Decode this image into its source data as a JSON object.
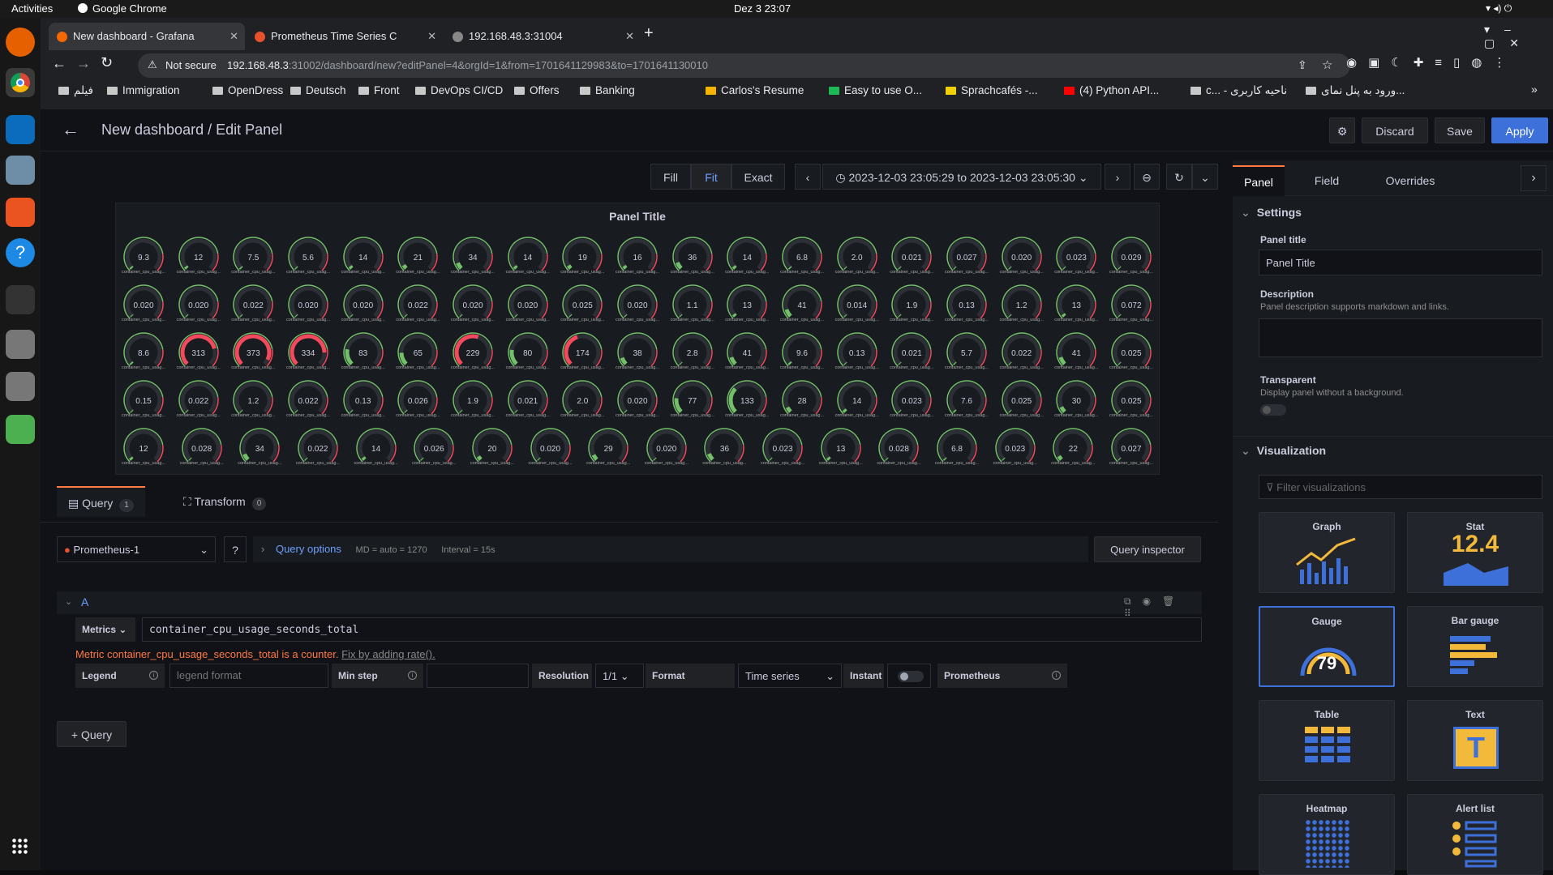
{
  "os": {
    "activities": "Activities",
    "app": "Google Chrome",
    "clock": "Dez 3  23:07"
  },
  "browser": {
    "tabs": [
      {
        "title": "New dashboard - Grafana",
        "active": true
      },
      {
        "title": "Prometheus Time Series C"
      },
      {
        "title": "192.168.48.3:31004"
      }
    ],
    "not_secure": "Not secure",
    "url_host": "192.168.48.3",
    "url_rest": ":31002/dashboard/new?editPanel=4&orgId=1&from=1701641129983&to=1701641130010",
    "bookmarks": [
      "فیلم",
      "Immigration",
      "OpenDress",
      "Deutsch",
      "Front",
      "DevOps CI/CD",
      "Offers",
      "Banking",
      "Carlos's Resume",
      "Easy to use O...",
      "Sprachcafés -...",
      "(4) Python API...",
      "c... - ناحیه کاربری",
      "ورود به پنل نمای..."
    ]
  },
  "header": {
    "breadcrumb": "New dashboard / Edit Panel",
    "discard": "Discard",
    "save": "Save",
    "apply": "Apply"
  },
  "toolbar": {
    "fill": "Fill",
    "fit": "Fit",
    "exact": "Exact",
    "time_range": "2023-12-03 23:05:29 to 2023-12-03 23:05:30"
  },
  "panel": {
    "title": "Panel Title",
    "gauge_label": "container_cpu_usag...",
    "gauges": [
      [
        "9.3",
        "12",
        "7.5",
        "5.6",
        "14",
        "21",
        "34",
        "14",
        "19",
        "16",
        "36",
        "14",
        "6.8",
        "2.0",
        "0.021",
        "0.027",
        "0.020",
        "0.023",
        "0.029"
      ],
      [
        "0.020",
        "0.020",
        "0.022",
        "0.020",
        "0.020",
        "0.022",
        "0.020",
        "0.020",
        "0.025",
        "0.020",
        "1.1",
        "13",
        "41",
        "0.014",
        "1.9",
        "0.13",
        "1.2",
        "13",
        "0.072"
      ],
      [
        "8.6",
        "313",
        "373",
        "334",
        "83",
        "65",
        "229",
        "80",
        "174",
        "38",
        "2.8",
        "41",
        "9.6",
        "0.13",
        "0.021",
        "5.7",
        "0.022",
        "41",
        "0.025"
      ],
      [
        "0.15",
        "0.022",
        "1.2",
        "0.022",
        "0.13",
        "0.026",
        "1.9",
        "0.021",
        "2.0",
        "0.020",
        "77",
        "133",
        "28",
        "14",
        "0.023",
        "7.6",
        "0.025",
        "30",
        "0.025"
      ],
      [
        "12",
        "0.028",
        "34",
        "0.022",
        "14",
        "0.026",
        "20",
        "0.020",
        "29",
        "0.020",
        "36",
        "0.023",
        "13",
        "0.028",
        "6.8",
        "0.023",
        "22",
        "0.027"
      ]
    ],
    "gauge_max": 400
  },
  "query": {
    "tab_query": "Query",
    "tab_query_count": "1",
    "tab_transform": "Transform",
    "tab_transform_count": "0",
    "datasource": "Prometheus-1",
    "query_options": "Query options",
    "md": "MD = auto = 1270",
    "interval": "Interval = 15s",
    "inspector": "Query inspector",
    "ref": "A",
    "metrics_label": "Metrics",
    "metric": "container_cpu_usage_seconds_total",
    "warning": "Metric container_cpu_usage_seconds_total is a counter.",
    "fix_link": "Fix by adding rate().",
    "legend": "Legend",
    "legend_placeholder": "legend format",
    "min_step": "Min step",
    "resolution": "Resolution",
    "resolution_value": "1/1",
    "format": "Format",
    "format_value": "Time series",
    "instant": "Instant",
    "prometheus": "Prometheus",
    "add_query": "Query"
  },
  "sidebar": {
    "tabs": [
      "Panel",
      "Field",
      "Overrides"
    ],
    "settings": "Settings",
    "panel_title_label": "Panel title",
    "panel_title_value": "Panel Title",
    "description_label": "Description",
    "description_hint": "Panel description supports markdown and links.",
    "transparent_label": "Transparent",
    "transparent_hint": "Display panel without a background.",
    "visualization": "Visualization",
    "filter_placeholder": "Filter visualizations",
    "viz": [
      "Graph",
      "Stat",
      "Gauge",
      "Bar gauge",
      "Table",
      "Text",
      "Heatmap",
      "Alert list"
    ],
    "stat_value": "12.4",
    "gauge_value": "79",
    "text_glyph": "T"
  },
  "colors": {
    "green": "#73bf69",
    "red": "#f2495c",
    "blue": "#3d71d9",
    "accent": "#ff7941"
  }
}
